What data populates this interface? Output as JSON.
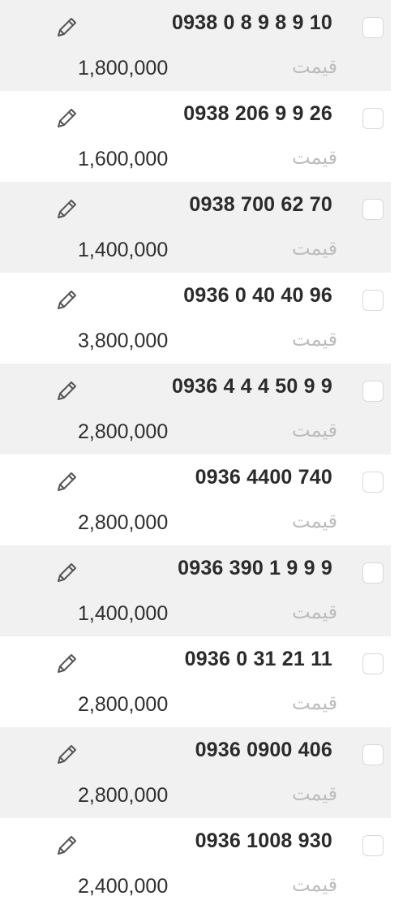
{
  "listings": [
    {
      "number": "0938 0 8 9 8 9 10",
      "price_label": "قیمت",
      "price": "1,800,000"
    },
    {
      "number": "0938 206 9 9 26",
      "price_label": "قیمت",
      "price": "1,600,000"
    },
    {
      "number": "0938 700 62 70",
      "price_label": "قیمت",
      "price": "1,400,000"
    },
    {
      "number": "0936 0 40 40 96",
      "price_label": "قیمت",
      "price": "3,800,000"
    },
    {
      "number": "0936 4 4 4 50 9 9",
      "price_label": "قیمت",
      "price": "2,800,000"
    },
    {
      "number": "0936 4400 740",
      "price_label": "قیمت",
      "price": "2,800,000"
    },
    {
      "number": "0936 390 1 9 9 9",
      "price_label": "قیمت",
      "price": "1,400,000"
    },
    {
      "number": "0936 0 31 21 11",
      "price_label": "قیمت",
      "price": "2,800,000"
    },
    {
      "number": "0936 0900 406",
      "price_label": "قیمت",
      "price": "2,800,000"
    },
    {
      "number": "0936 1008 930",
      "price_label": "قیمت",
      "price": "2,400,000"
    }
  ],
  "icons": {
    "edit": "pencil-icon",
    "select": "checkbox"
  },
  "colors": {
    "shaded_row": "#f1f1f1",
    "plain_row": "#ffffff",
    "number_text": "#2b2b2b",
    "label_text": "#bdbdbd",
    "price_text": "#2f2f2f",
    "checkbox_border": "#d9d9d9"
  }
}
